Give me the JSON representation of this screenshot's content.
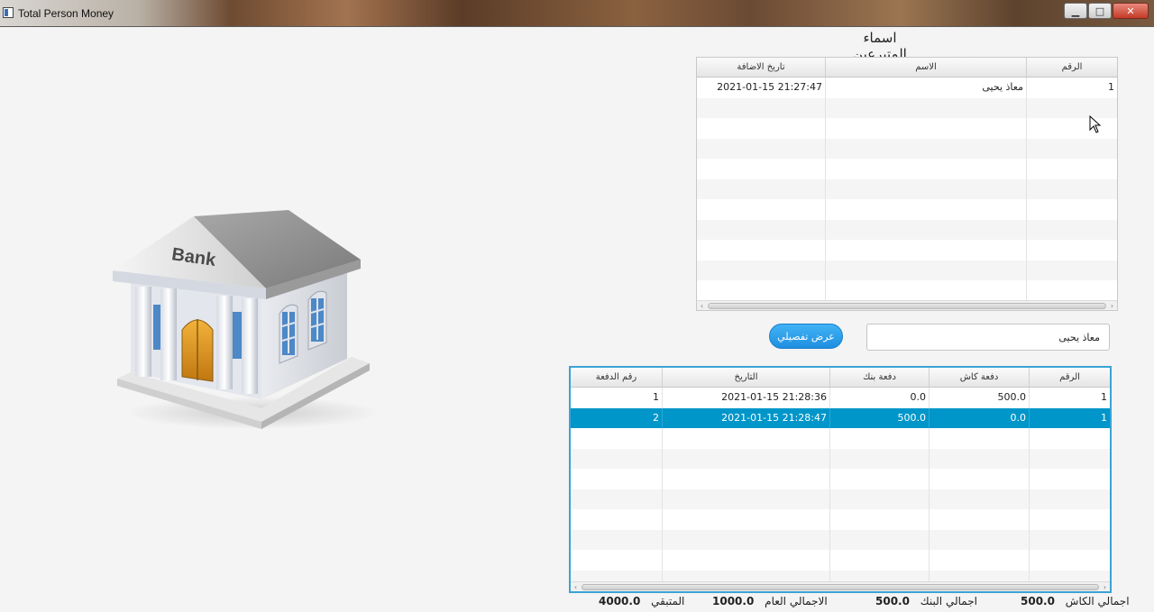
{
  "window": {
    "title": "Total Person Money",
    "minimize_glyph": "▁",
    "maximize_glyph": "□",
    "close_glyph": "✕"
  },
  "bank_icon": {
    "label": "Bank"
  },
  "donors": {
    "heading": "اسماء المتبرعين",
    "columns": [
      "الرقم",
      "الاسم",
      "تاريخ الاضافة"
    ],
    "rows": [
      {
        "id": "1",
        "name": "معاذ يحيى",
        "added": "2021-01-15 21:27:47"
      }
    ]
  },
  "detail_button": {
    "label": "عرض تفصيلي"
  },
  "name_input": {
    "value": "معاذ يحيى"
  },
  "payments": {
    "columns": [
      "الرقم",
      "دفعة كاش",
      "دفعة بنك",
      "التاريخ",
      "رقم الدفعة"
    ],
    "rows": [
      {
        "id": "1",
        "cash": "500.0",
        "bank": "0.0",
        "date": "2021-01-15 21:28:36",
        "payment_no": "1",
        "selected": false
      },
      {
        "id": "1",
        "cash": "0.0",
        "bank": "500.0",
        "date": "2021-01-15 21:28:47",
        "payment_no": "2",
        "selected": true
      }
    ],
    "selection_color": "#0096c9"
  },
  "totals": {
    "cash_label": "اجمالي الكاش",
    "cash_value": "500.0",
    "bank_label": "اجمالي البنك",
    "bank_value": "500.0",
    "grand_label": "الاجمالي العام",
    "grand_value": "1000.0",
    "remaining_label": "المتبقي",
    "remaining_value": "4000.0"
  }
}
